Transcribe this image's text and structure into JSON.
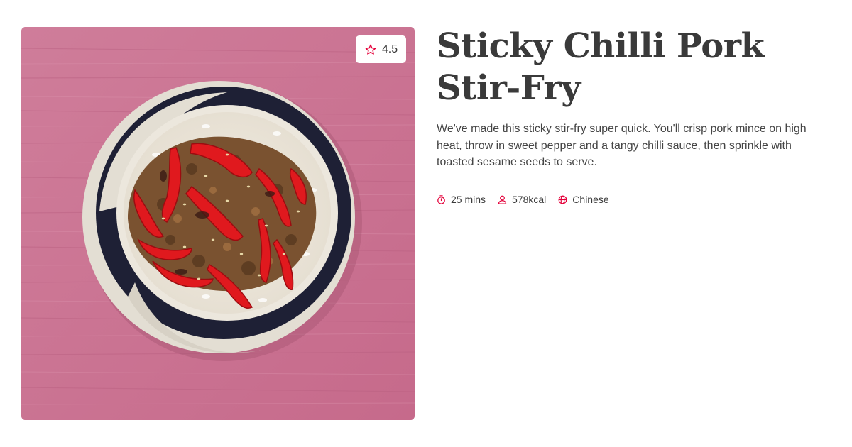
{
  "recipe": {
    "title": "Sticky Chilli Pork Stir-Fry",
    "description": "We've made this sticky stir-fry super quick. You'll crisp pork mince on high heat, throw in sweet pepper and a tangy chilli sauce, then sprinkle with toasted sesame seeds to serve.",
    "rating": "4.5",
    "image_icon": "recipe-photo"
  },
  "meta": {
    "time": {
      "label": "25 mins",
      "icon": "timer-icon"
    },
    "calories": {
      "label": "578kcal",
      "icon": "person-icon"
    },
    "cuisine": {
      "label": "Chinese",
      "icon": "globe-icon"
    }
  },
  "colors": {
    "accent": "#e4003a",
    "text": "#3a3a3a",
    "background": "#ffffff"
  }
}
